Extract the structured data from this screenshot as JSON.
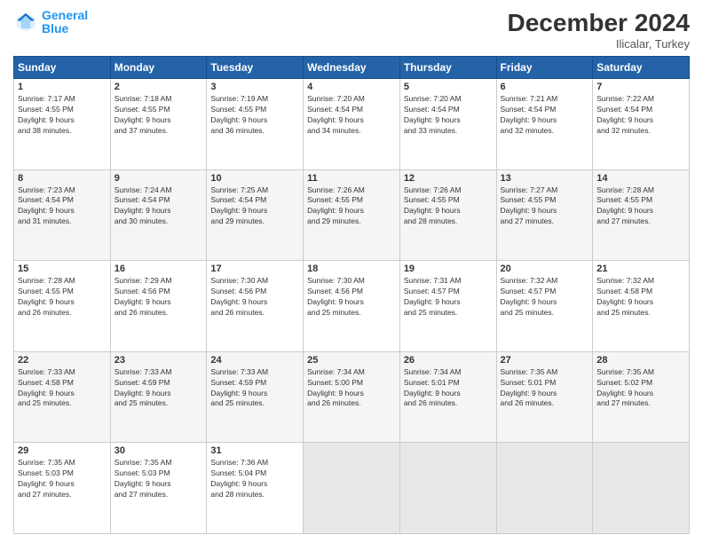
{
  "header": {
    "logo_line1": "General",
    "logo_line2": "Blue",
    "month_year": "December 2024",
    "location": "Ilicalar, Turkey"
  },
  "weekdays": [
    "Sunday",
    "Monday",
    "Tuesday",
    "Wednesday",
    "Thursday",
    "Friday",
    "Saturday"
  ],
  "weeks": [
    [
      {
        "day": "1",
        "info": "Sunrise: 7:17 AM\nSunset: 4:55 PM\nDaylight: 9 hours\nand 38 minutes."
      },
      {
        "day": "2",
        "info": "Sunrise: 7:18 AM\nSunset: 4:55 PM\nDaylight: 9 hours\nand 37 minutes."
      },
      {
        "day": "3",
        "info": "Sunrise: 7:19 AM\nSunset: 4:55 PM\nDaylight: 9 hours\nand 36 minutes."
      },
      {
        "day": "4",
        "info": "Sunrise: 7:20 AM\nSunset: 4:54 PM\nDaylight: 9 hours\nand 34 minutes."
      },
      {
        "day": "5",
        "info": "Sunrise: 7:20 AM\nSunset: 4:54 PM\nDaylight: 9 hours\nand 33 minutes."
      },
      {
        "day": "6",
        "info": "Sunrise: 7:21 AM\nSunset: 4:54 PM\nDaylight: 9 hours\nand 32 minutes."
      },
      {
        "day": "7",
        "info": "Sunrise: 7:22 AM\nSunset: 4:54 PM\nDaylight: 9 hours\nand 32 minutes."
      }
    ],
    [
      {
        "day": "8",
        "info": "Sunrise: 7:23 AM\nSunset: 4:54 PM\nDaylight: 9 hours\nand 31 minutes."
      },
      {
        "day": "9",
        "info": "Sunrise: 7:24 AM\nSunset: 4:54 PM\nDaylight: 9 hours\nand 30 minutes."
      },
      {
        "day": "10",
        "info": "Sunrise: 7:25 AM\nSunset: 4:54 PM\nDaylight: 9 hours\nand 29 minutes."
      },
      {
        "day": "11",
        "info": "Sunrise: 7:26 AM\nSunset: 4:55 PM\nDaylight: 9 hours\nand 29 minutes."
      },
      {
        "day": "12",
        "info": "Sunrise: 7:26 AM\nSunset: 4:55 PM\nDaylight: 9 hours\nand 28 minutes."
      },
      {
        "day": "13",
        "info": "Sunrise: 7:27 AM\nSunset: 4:55 PM\nDaylight: 9 hours\nand 27 minutes."
      },
      {
        "day": "14",
        "info": "Sunrise: 7:28 AM\nSunset: 4:55 PM\nDaylight: 9 hours\nand 27 minutes."
      }
    ],
    [
      {
        "day": "15",
        "info": "Sunrise: 7:28 AM\nSunset: 4:55 PM\nDaylight: 9 hours\nand 26 minutes."
      },
      {
        "day": "16",
        "info": "Sunrise: 7:29 AM\nSunset: 4:56 PM\nDaylight: 9 hours\nand 26 minutes."
      },
      {
        "day": "17",
        "info": "Sunrise: 7:30 AM\nSunset: 4:56 PM\nDaylight: 9 hours\nand 26 minutes."
      },
      {
        "day": "18",
        "info": "Sunrise: 7:30 AM\nSunset: 4:56 PM\nDaylight: 9 hours\nand 25 minutes."
      },
      {
        "day": "19",
        "info": "Sunrise: 7:31 AM\nSunset: 4:57 PM\nDaylight: 9 hours\nand 25 minutes."
      },
      {
        "day": "20",
        "info": "Sunrise: 7:32 AM\nSunset: 4:57 PM\nDaylight: 9 hours\nand 25 minutes."
      },
      {
        "day": "21",
        "info": "Sunrise: 7:32 AM\nSunset: 4:58 PM\nDaylight: 9 hours\nand 25 minutes."
      }
    ],
    [
      {
        "day": "22",
        "info": "Sunrise: 7:33 AM\nSunset: 4:58 PM\nDaylight: 9 hours\nand 25 minutes."
      },
      {
        "day": "23",
        "info": "Sunrise: 7:33 AM\nSunset: 4:59 PM\nDaylight: 9 hours\nand 25 minutes."
      },
      {
        "day": "24",
        "info": "Sunrise: 7:33 AM\nSunset: 4:59 PM\nDaylight: 9 hours\nand 25 minutes."
      },
      {
        "day": "25",
        "info": "Sunrise: 7:34 AM\nSunset: 5:00 PM\nDaylight: 9 hours\nand 26 minutes."
      },
      {
        "day": "26",
        "info": "Sunrise: 7:34 AM\nSunset: 5:01 PM\nDaylight: 9 hours\nand 26 minutes."
      },
      {
        "day": "27",
        "info": "Sunrise: 7:35 AM\nSunset: 5:01 PM\nDaylight: 9 hours\nand 26 minutes."
      },
      {
        "day": "28",
        "info": "Sunrise: 7:35 AM\nSunset: 5:02 PM\nDaylight: 9 hours\nand 27 minutes."
      }
    ],
    [
      {
        "day": "29",
        "info": "Sunrise: 7:35 AM\nSunset: 5:03 PM\nDaylight: 9 hours\nand 27 minutes."
      },
      {
        "day": "30",
        "info": "Sunrise: 7:35 AM\nSunset: 5:03 PM\nDaylight: 9 hours\nand 27 minutes."
      },
      {
        "day": "31",
        "info": "Sunrise: 7:36 AM\nSunset: 5:04 PM\nDaylight: 9 hours\nand 28 minutes."
      },
      {
        "day": "",
        "info": ""
      },
      {
        "day": "",
        "info": ""
      },
      {
        "day": "",
        "info": ""
      },
      {
        "day": "",
        "info": ""
      }
    ]
  ]
}
